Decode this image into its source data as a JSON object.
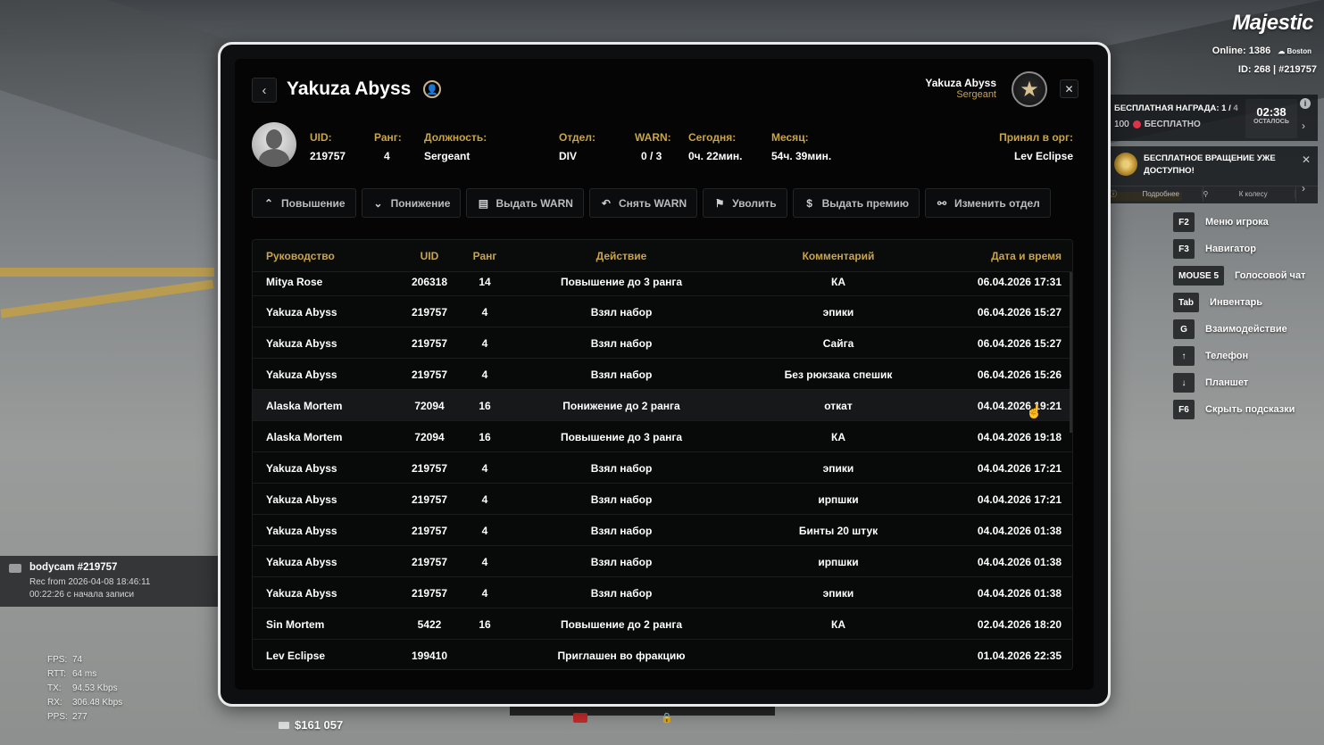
{
  "hud": {
    "brand": "Majestic",
    "online_label": "Online: 1386",
    "server_name": "Boston",
    "player_id": "ID: 268 | #219757",
    "reward": {
      "title": "БЕСПЛАТНАЯ НАГРАДА: 1 /",
      "title_total": "4",
      "amount": "100",
      "free_label": "БЕСПЛАТНО",
      "timer": "02:38",
      "timer_label": "ОСТАЛОСЬ"
    },
    "spin": {
      "text": "БЕСПЛАТНОЕ ВРАЩЕНИЕ УЖЕ ДОСТУПНО!",
      "link_more": "Подробнее",
      "link_wheel": "К колесу"
    },
    "hints": [
      {
        "key": "F2",
        "label": "Меню игрока"
      },
      {
        "key": "F3",
        "label": "Навигатор"
      },
      {
        "key": "MOUSE 5",
        "label": "Голосовой чат"
      },
      {
        "key": "Tab",
        "label": "Инвентарь"
      },
      {
        "key": "G",
        "label": "Взаимодействие"
      },
      {
        "key": "↑",
        "label": "Телефон"
      },
      {
        "key": "↓",
        "label": "Планшет"
      },
      {
        "key": "F6",
        "label": "Скрыть подсказки"
      }
    ],
    "bodycam": {
      "title": "bodycam #219757",
      "rec": "Rec from 2026-04-08 18:46:11",
      "elapsed": "00:22:26 с начала записи"
    },
    "stats": [
      {
        "k": "FPS:",
        "v": "74"
      },
      {
        "k": "RTT:",
        "v": "64 ms"
      },
      {
        "k": "TX:",
        "v": "94.53 Kbps"
      },
      {
        "k": "RX:",
        "v": "306.48 Kbps"
      },
      {
        "k": "PPS:",
        "v": "277"
      }
    ],
    "money": "$161 057"
  },
  "modal": {
    "title": "Yakuza Abyss",
    "me_name": "Yakuza Abyss",
    "me_rank": "Sergeant",
    "info": [
      {
        "k": "UID:",
        "v": "219757"
      },
      {
        "k": "Ранг:",
        "v": "4"
      },
      {
        "k": "Должность:",
        "v": "Sergeant"
      },
      {
        "k": "Отдел:",
        "v": "DIV"
      },
      {
        "k": "WARN:",
        "v": "0 / 3"
      },
      {
        "k": "Сегодня:",
        "v": "0ч. 22мин."
      },
      {
        "k": "Месяц:",
        "v": "54ч. 39мин."
      },
      {
        "k": "Принял в орг:",
        "v": "Lev Eclipse"
      }
    ],
    "actions": [
      {
        "label": "Повышение",
        "icon": "chevron-up-icon"
      },
      {
        "label": "Понижение",
        "icon": "chevron-down-icon"
      },
      {
        "label": "Выдать WARN",
        "icon": "warn-doc-icon"
      },
      {
        "label": "Снять WARN",
        "icon": "undo-icon"
      },
      {
        "label": "Уволить",
        "icon": "fire-person-icon"
      },
      {
        "label": "Выдать премию",
        "icon": "coin-icon"
      },
      {
        "label": "Изменить отдел",
        "icon": "org-chart-icon"
      }
    ],
    "table": {
      "headers": [
        "Руководство",
        "UID",
        "Ранг",
        "Действие",
        "Комментарий",
        "Дата и время"
      ],
      "rows": [
        [
          "Mitya Rose",
          "206318",
          "14",
          "Повышение до 3 ранга",
          "КА",
          "06.04.2026 17:31"
        ],
        [
          "Yakuza Abyss",
          "219757",
          "4",
          "Взял набор",
          "эпики",
          "06.04.2026 15:27"
        ],
        [
          "Yakuza Abyss",
          "219757",
          "4",
          "Взял набор",
          "Сайга",
          "06.04.2026 15:27"
        ],
        [
          "Yakuza Abyss",
          "219757",
          "4",
          "Взял набор",
          "Без рюкзака спешик",
          "06.04.2026 15:26"
        ],
        [
          "Alaska Mortem",
          "72094",
          "16",
          "Понижение до 2 ранга",
          "откат",
          "04.04.2026 19:21"
        ],
        [
          "Alaska Mortem",
          "72094",
          "16",
          "Повышение до 3 ранга",
          "КА",
          "04.04.2026 19:18"
        ],
        [
          "Yakuza Abyss",
          "219757",
          "4",
          "Взял набор",
          "эпики",
          "04.04.2026 17:21"
        ],
        [
          "Yakuza Abyss",
          "219757",
          "4",
          "Взял набор",
          "ирпшки",
          "04.04.2026 17:21"
        ],
        [
          "Yakuza Abyss",
          "219757",
          "4",
          "Взял набор",
          "Бинты 20 штук",
          "04.04.2026 01:38"
        ],
        [
          "Yakuza Abyss",
          "219757",
          "4",
          "Взял набор",
          "ирпшки",
          "04.04.2026 01:38"
        ],
        [
          "Yakuza Abyss",
          "219757",
          "4",
          "Взял набор",
          "эпики",
          "04.04.2026 01:38"
        ],
        [
          "Sin Mortem",
          "5422",
          "16",
          "Повышение до 2 ранга",
          "КА",
          "02.04.2026 18:20"
        ],
        [
          "Lev Eclipse",
          "199410",
          "",
          "Приглашен во фракцию",
          "",
          "01.04.2026 22:35"
        ]
      ]
    }
  }
}
